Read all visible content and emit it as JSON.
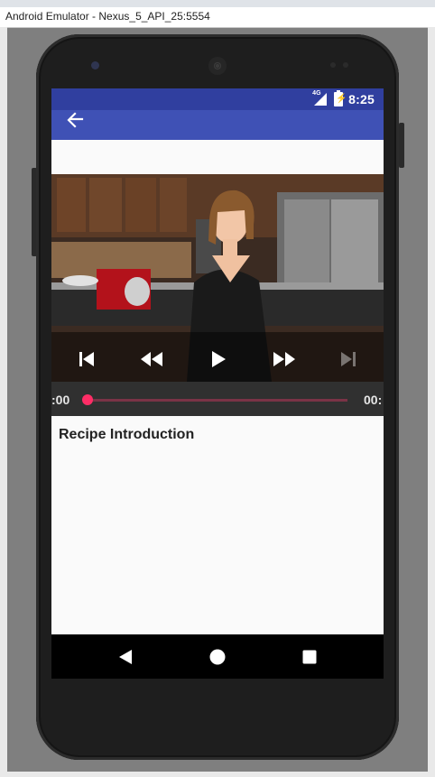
{
  "window": {
    "title": "Android Emulator - Nexus_5_API_25:5554"
  },
  "status_bar": {
    "network": "4G",
    "time": "8:25"
  },
  "app_bar": {
    "back_icon": "arrow-back-icon"
  },
  "player": {
    "time_current": ":00",
    "time_total": "00:",
    "progress_fraction": 0.0,
    "controls": [
      "skip-previous-icon",
      "rewind-icon",
      "play-icon",
      "fast-forward-icon",
      "skip-next-icon"
    ]
  },
  "step": {
    "title": "Recipe Introduction"
  },
  "nav": {
    "buttons": [
      "back-triangle-icon",
      "home-circle-icon",
      "recents-square-icon"
    ]
  },
  "colors": {
    "status_bar": "#303f9f",
    "app_bar": "#3f51b5",
    "accent": "#ff2d66"
  }
}
